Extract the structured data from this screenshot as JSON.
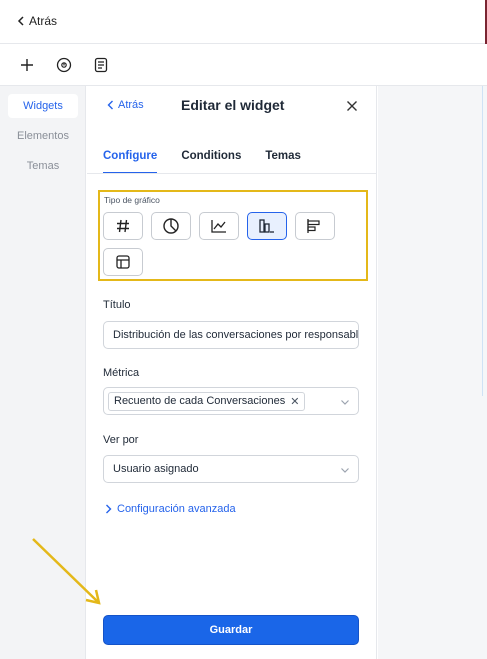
{
  "topbar": {
    "back_label": "Atrás"
  },
  "toolbar": {
    "icons": [
      "plus-icon",
      "circle-info-icon",
      "document-icon"
    ]
  },
  "leftnav": {
    "items": [
      {
        "label": "Widgets"
      },
      {
        "label": "Elementos"
      },
      {
        "label": "Temas"
      }
    ]
  },
  "panel": {
    "back_label": "Atrás",
    "title": "Editar el widget",
    "tabs": [
      {
        "label": "Configure"
      },
      {
        "label": "Conditions"
      },
      {
        "label": "Temas"
      }
    ],
    "chart_type": {
      "label": "Tipo de gráfico",
      "options": [
        "number-icon",
        "pie-chart-icon",
        "line-chart-icon",
        "vertical-bar-icon",
        "horizontal-bar-icon",
        "table-icon"
      ],
      "selected": "vertical-bar-icon"
    },
    "title_field": {
      "label": "Título",
      "value": "Distribución de las conversaciones por responsable"
    },
    "metric_field": {
      "label": "Métrica",
      "chip": "Recuento de cada Conversaciones"
    },
    "groupby_field": {
      "label": "Ver por",
      "value": "Usuario asignado"
    },
    "advanced_label": "Configuración avanzada",
    "save_label": "Guardar"
  },
  "colors": {
    "accent": "#2563eb",
    "highlight": "#e4b819",
    "save": "#1a66e8"
  }
}
